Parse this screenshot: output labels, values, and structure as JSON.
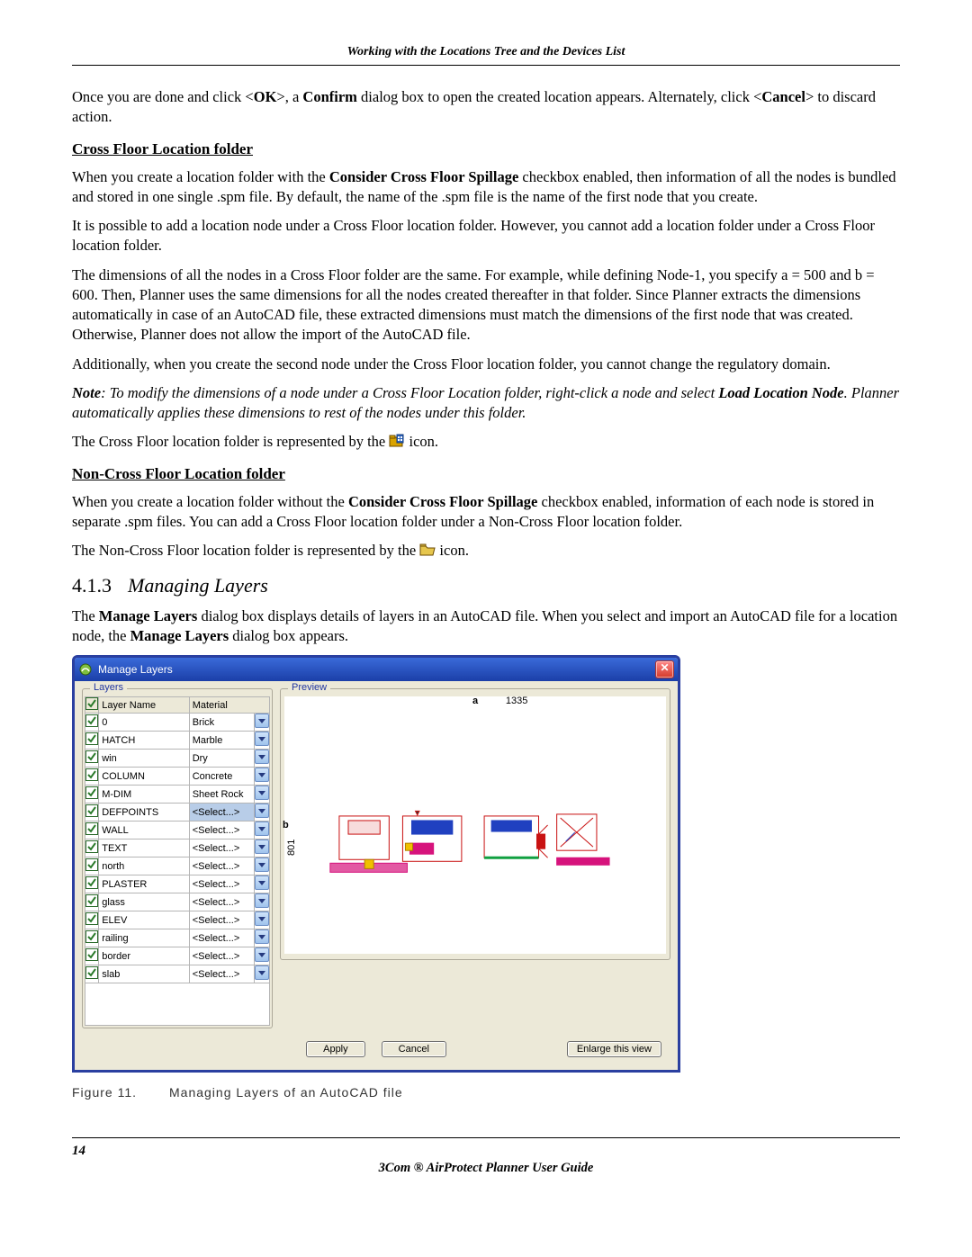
{
  "header_title": "Working with the Locations Tree and the Devices List",
  "p_intro_1a": "Once you are done and click <",
  "p_intro_1b": "OK",
  "p_intro_1c": ">, a ",
  "p_intro_1d": "Confirm",
  "p_intro_1e": " dialog box to open the created location appears. Alternately, click <",
  "p_intro_1f": "Cancel",
  "p_intro_1g": "> to discard action.",
  "sub_cross": "Cross Floor Location folder",
  "p_cross_1a": "When you create a location folder with the ",
  "p_cross_1b": "Consider Cross Floor Spillage",
  "p_cross_1c": " checkbox enabled, then information of all the nodes is bundled and stored in one single .spm file. By default, the name of the .spm file is the name of the first node that you create.",
  "p_cross_2": "It is possible to add a location node under a Cross Floor location folder. However, you cannot add a location folder under a Cross Floor location folder.",
  "p_cross_3": "The dimensions of all the nodes in a Cross Floor folder are the same. For example, while defining Node-1, you specify a = 500 and b = 600. Then, Planner uses the same dimensions for all the nodes created thereafter in that folder. Since Planner extracts the dimensions automatically in case of an AutoCAD file, these extracted dimensions must match the dimensions of the first node that was created. Otherwise, Planner does not allow the import of the AutoCAD file.",
  "p_cross_4": "Additionally, when you create the second node under the Cross Floor location folder, you cannot change the regulatory domain.",
  "note_1a": "Note",
  "note_1b": ": To modify the dimensions of a node under a Cross Floor Location folder, right-click a node and select ",
  "note_1c": "Load Location Node",
  "note_1d": ". Planner automatically applies these dimensions to rest of the nodes under this folder.",
  "p_cross_icon_a": "The Cross Floor location folder is represented by the ",
  "p_cross_icon_b": " icon.",
  "sub_noncross": "Non-Cross Floor Location folder",
  "p_nc_1a": "When you create a location folder without the ",
  "p_nc_1b": "Consider Cross Floor Spillage",
  "p_nc_1c": " checkbox enabled, information of each node is stored in separate .spm files. You can add a Cross Floor location folder under a Non-Cross Floor location folder.",
  "p_nc_icon_a": "The Non-Cross Floor location folder is represented by the ",
  "p_nc_icon_b": " icon.",
  "sect_num": "4.1.3",
  "sect_title": "Managing Layers",
  "p_ml_1a": "The ",
  "p_ml_1b": "Manage Layers",
  "p_ml_1c": " dialog box displays details of layers in an AutoCAD file. When you select and import an AutoCAD file for a location node, the ",
  "p_ml_1d": "Manage Layers",
  "p_ml_1e": " dialog box appears.",
  "dialog": {
    "title": "Manage Layers",
    "group_layers": "Layers",
    "col_name": "Layer Name",
    "col_material": "Material",
    "rows": [
      {
        "name": "0",
        "material": "Brick"
      },
      {
        "name": "HATCH",
        "material": "Marble"
      },
      {
        "name": "win",
        "material": "Dry"
      },
      {
        "name": "COLUMN",
        "material": "Concrete"
      },
      {
        "name": "M-DIM",
        "material": "Sheet Rock"
      },
      {
        "name": "DEFPOINTS",
        "material": "<Select...>"
      },
      {
        "name": "WALL",
        "material": "<Select...>"
      },
      {
        "name": "TEXT",
        "material": "<Select...>"
      },
      {
        "name": "north",
        "material": "<Select...>"
      },
      {
        "name": "PLASTER",
        "material": "<Select...>"
      },
      {
        "name": "glass",
        "material": "<Select...>"
      },
      {
        "name": "ELEV",
        "material": "<Select...>"
      },
      {
        "name": "railing",
        "material": "<Select...>"
      },
      {
        "name": "border",
        "material": "<Select...>"
      },
      {
        "name": "slab",
        "material": "<Select...>"
      }
    ],
    "group_preview": "Preview",
    "axis_a": "a",
    "axis_a_val": "1335",
    "axis_b": "b",
    "axis_b_val": "801",
    "btn_apply": "Apply",
    "btn_cancel": "Cancel",
    "btn_enlarge": "Enlarge this view"
  },
  "fig_label": "Figure 11.",
  "fig_title": "Managing Layers of an AutoCAD file",
  "page_num": "14",
  "footer_title": "3Com ® AirProtect Planner User Guide"
}
